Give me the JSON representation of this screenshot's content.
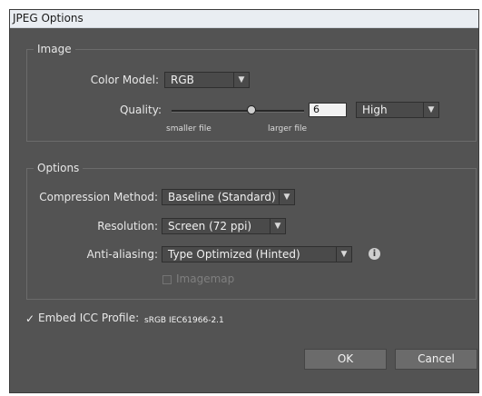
{
  "window": {
    "title": "JPEG Options"
  },
  "image_group": {
    "label": "Image",
    "color_model": {
      "label": "Color Model:",
      "value": "RGB"
    },
    "quality": {
      "label": "Quality:",
      "value_number": "6",
      "level": 0.6,
      "preset": "High",
      "left_caption": "smaller file",
      "right_caption": "larger file"
    }
  },
  "options_group": {
    "label": "Options",
    "compression_method": {
      "label": "Compression Method:",
      "value": "Baseline (Standard)"
    },
    "resolution": {
      "label": "Resolution:",
      "value": "Screen (72 ppi)"
    },
    "anti_aliasing": {
      "label": "Anti-aliasing:",
      "value": "Type Optimized (Hinted)",
      "info_icon": "info-icon"
    },
    "imagemap": {
      "label": "Imagemap",
      "checked": false,
      "enabled": false
    }
  },
  "icc_profile": {
    "label": "Embed ICC Profile:",
    "value": "sRGB IEC61966-2.1",
    "checked": true
  },
  "buttons": {
    "ok": "OK",
    "cancel": "Cancel"
  },
  "icons": {
    "dropdown": "chevron-down-icon",
    "checkbox_checked": "check-icon",
    "info": "info-icon"
  },
  "colors": {
    "dialog_bg": "#535353",
    "titlebar_bg": "#e9edf2",
    "text": "#e8e8e8",
    "input_bg": "#4a4a4a",
    "button_bg": "#6b6b6b",
    "disabled_text": "#7f7f7f"
  }
}
